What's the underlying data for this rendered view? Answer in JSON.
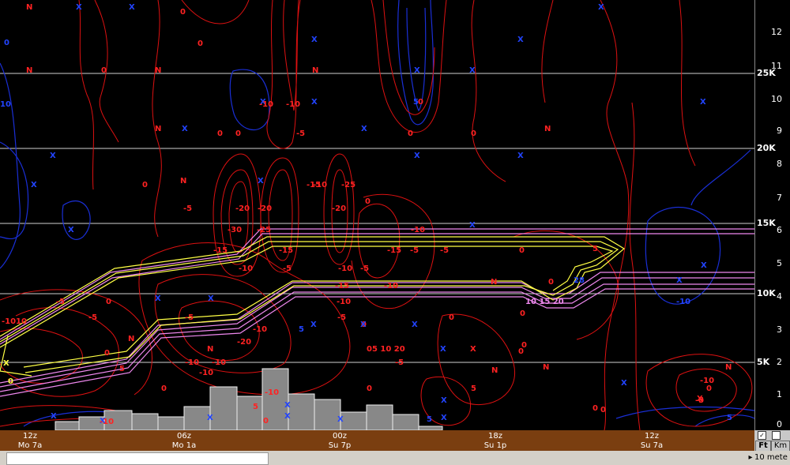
{
  "colors": {
    "background": "#000000",
    "red_contours": "#dd1111",
    "blue_contours": "#1a2fd6",
    "freezing_line": "#ffff44",
    "pink_lines": "#ee88ee",
    "bars": "#888888",
    "grid": "#ffffff",
    "time_axis_bg": "#7a3e10"
  },
  "right_axis": {
    "km_ticks": [
      "12",
      "11",
      "10",
      "9",
      "8",
      "7",
      "6",
      "5",
      "4",
      "3",
      "2",
      "1",
      "0"
    ],
    "ft_ticks": [
      "25K",
      "20K",
      "15K",
      "10K",
      "5K"
    ]
  },
  "time_axis": {
    "ticks": [
      {
        "utc": "12z",
        "local": "Mo 7a"
      },
      {
        "utc": "06z",
        "local": "Mo 1a"
      },
      {
        "utc": "00z",
        "local": "Su 7p"
      },
      {
        "utc": "18z",
        "local": "Su 1p"
      },
      {
        "utc": "12z",
        "local": "Su 7a"
      }
    ]
  },
  "controls": {
    "checkbox1_checked": "✓",
    "unit_ft": "Ft",
    "unit_km": "Km"
  },
  "status": {
    "arrow": "▸",
    "text": "10 mete"
  },
  "plot_labels": [
    "N",
    "X",
    "X",
    "0",
    "X",
    "0",
    "X",
    "N",
    "X",
    "N",
    "0",
    "N",
    "X",
    "X",
    "0",
    "X",
    "X",
    "0",
    "N",
    "X",
    "0",
    "N",
    "0",
    "X",
    "-10",
    "X",
    "-10",
    "10",
    "X",
    "X",
    "0",
    "-5",
    "X",
    "X",
    "5",
    "0",
    "0",
    "0",
    "N",
    "X",
    "-15",
    "-10",
    "-25",
    "-20",
    "-5",
    "-30",
    "-25",
    "X",
    "-10",
    "X",
    "-5",
    "-20",
    "-15",
    "-20",
    "-15",
    "-10",
    "-15",
    "10",
    "-5",
    "0",
    "-5",
    "-5",
    "-10",
    "-5",
    "5",
    "0",
    "X",
    "X",
    "-15",
    "-10",
    "-20",
    "X",
    "-5",
    "-5",
    "N",
    "X",
    "0",
    "-10",
    "-5",
    "-10",
    "-10",
    "5",
    "0",
    "N",
    "X",
    "0",
    "0",
    "X",
    "0",
    "X",
    "5",
    "-10",
    "X",
    "-5",
    "N",
    "0",
    "-10",
    "X",
    "0",
    "0",
    "X",
    "-10",
    "-10",
    "N",
    "5",
    "N",
    "X",
    "X",
    "-10",
    "5",
    "-5",
    "N",
    "0",
    "X",
    "X",
    "5",
    "0",
    "0",
    "X",
    "X",
    "0",
    "X",
    "-10",
    "X",
    "-10",
    "5",
    "0",
    "X",
    "10 15 20",
    "28",
    "05 10 20",
    "X",
    "0",
    "0",
    "0",
    "-5"
  ]
}
